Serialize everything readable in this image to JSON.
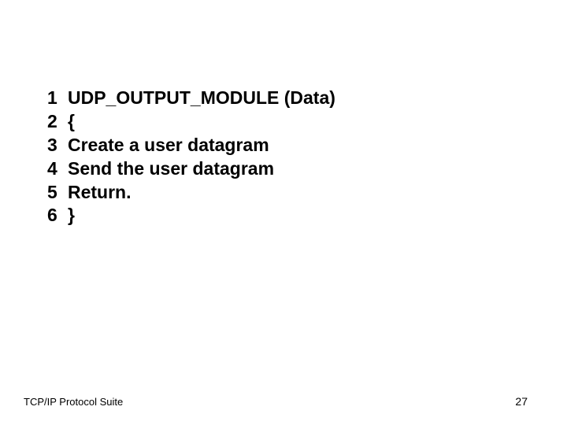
{
  "code": {
    "lines": [
      {
        "n": "1",
        "text": "UDP_OUTPUT_MODULE (Data)"
      },
      {
        "n": "2",
        "text": "{"
      },
      {
        "n": "3",
        "text": "Create a user datagram"
      },
      {
        "n": "4",
        "text": "Send the user datagram"
      },
      {
        "n": "5",
        "text": "Return."
      },
      {
        "n": "6",
        "text": "}"
      }
    ]
  },
  "footer": "TCP/IP Protocol Suite",
  "page_number": "27"
}
